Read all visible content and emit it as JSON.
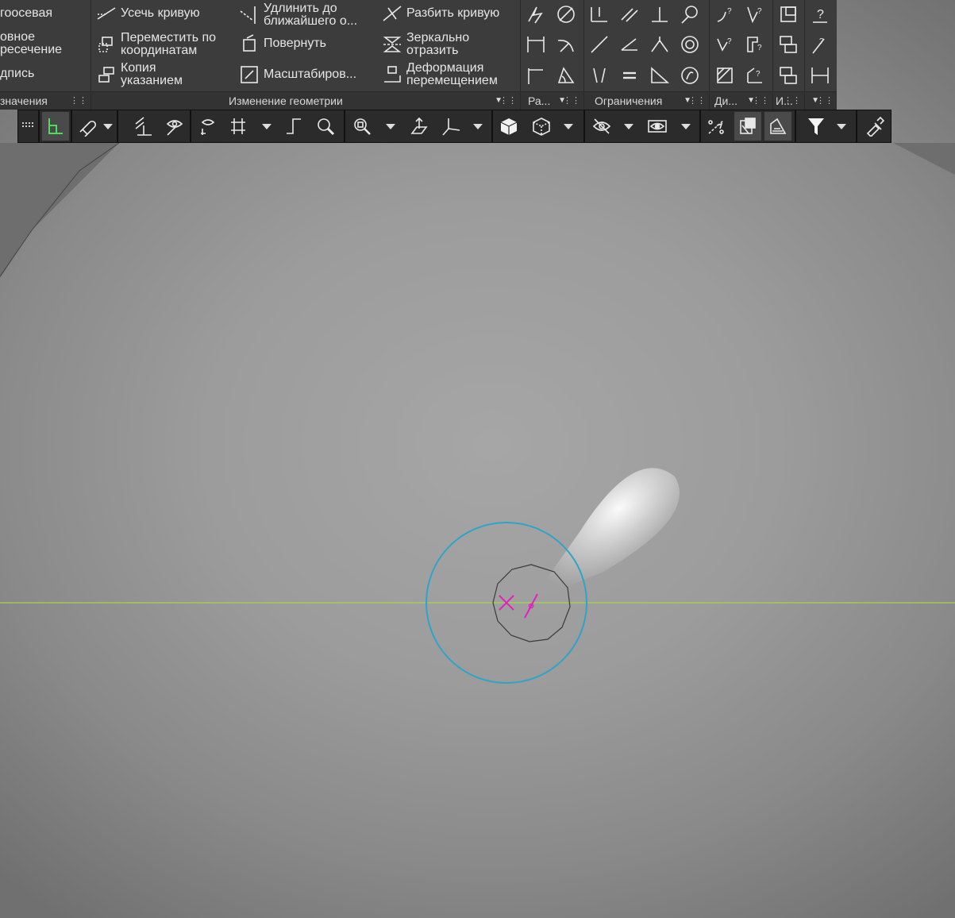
{
  "ribbon": {
    "left_partial": {
      "item1": "гоосевая",
      "item2_line1": "овное",
      "item2_line2": "ресечение",
      "item3": "дпись",
      "footer": "значения"
    },
    "geometry": {
      "footer": "Изменение геометрии",
      "trim": "Усечь кривую",
      "move_by_coords_l1": "Переместить по",
      "move_by_coords_l2": "координатам",
      "copy_l1": "Копия",
      "copy_l2": "указанием",
      "extend_l1": "Удлинить до",
      "extend_l2": "ближайшего о...",
      "rotate": "Повернуть",
      "scale": "Масштабиров...",
      "split": "Разбить кривую",
      "mirror_l1": "Зеркально",
      "mirror_l2": "отразить",
      "deform_l1": "Деформация",
      "deform_l2": "перемещением"
    },
    "dimensions_footer": "Ра...",
    "constraints_footer": "Ограничения",
    "diagnostics_footer": "Ди...",
    "i_footer": "И..."
  },
  "colors": {
    "ribbon_bg": "#3c3c3c",
    "toolbar_bg": "#2b2b2b",
    "construction_line": "#9fd84a",
    "circle_outer": "#2fa3c8",
    "marker": "#e020c0"
  },
  "icons": {
    "toolbar": [
      "drag-handle-icon",
      "sketch-icon",
      "magnet-snap-icon",
      "perpendicular-snap-icon",
      "display-eye-icon",
      "view-orient-icon",
      "grid-icon",
      "step-icon",
      "zoom-icon",
      "zoom-window-icon",
      "normal-to-icon",
      "triad-icon",
      "shaded-cube-icon",
      "wireframe-cube-icon",
      "hide-icon",
      "hide-eye-icon",
      "select-points-icon",
      "component-icon",
      "layers-icon",
      "filter-icon",
      "eyedropper-icon"
    ]
  }
}
